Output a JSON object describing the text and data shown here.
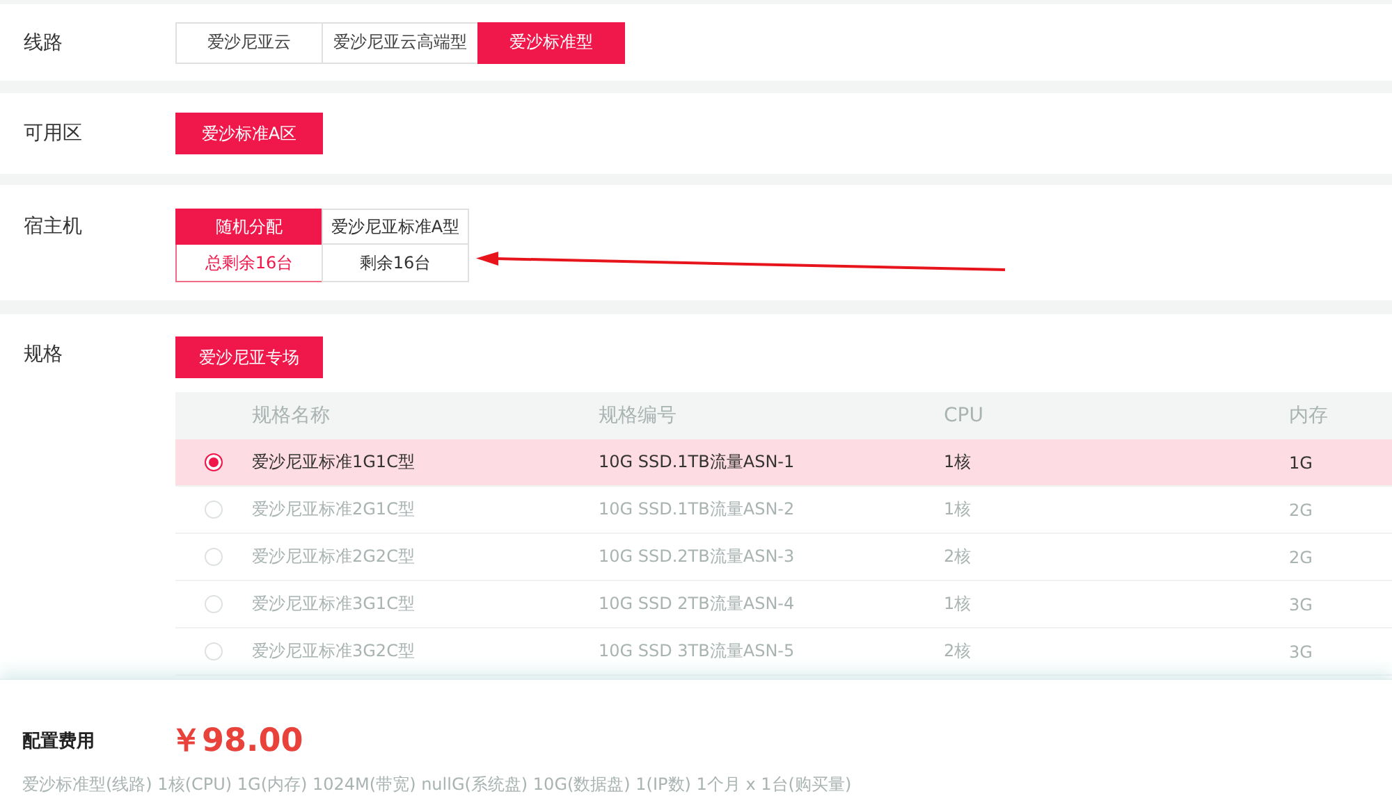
{
  "line": {
    "label": "线路",
    "options": [
      {
        "label": "爱沙尼亚云",
        "selected": false
      },
      {
        "label": "爱沙尼亚云高端型",
        "selected": false
      },
      {
        "label": "爱沙标准型",
        "selected": true
      }
    ]
  },
  "zone": {
    "label": "可用区",
    "options": [
      {
        "label": "爱沙标准A区",
        "selected": true
      }
    ]
  },
  "host": {
    "label": "宿主机",
    "options": [
      {
        "name": "随机分配",
        "remaining": "总剩余16台",
        "selected": true
      },
      {
        "name": "爱沙尼亚标准A型",
        "remaining": "剩余16台",
        "selected": false
      }
    ]
  },
  "spec": {
    "label": "规格",
    "groups": [
      {
        "label": "爱沙尼亚专场",
        "selected": true
      }
    ],
    "table": {
      "columns": [
        "规格名称",
        "规格编号",
        "CPU",
        "内存"
      ],
      "rows": [
        {
          "selected": true,
          "cells": [
            "爱沙尼亚标准1G1C型",
            "10G SSD.1TB流量ASN-1",
            "1核",
            "1G"
          ]
        },
        {
          "selected": false,
          "cells": [
            "爱沙尼亚标准2G1C型",
            "10G SSD.1TB流量ASN-2",
            "1核",
            "2G"
          ]
        },
        {
          "selected": false,
          "cells": [
            "爱沙尼亚标准2G2C型",
            "10G SSD.2TB流量ASN-3",
            "2核",
            "2G"
          ]
        },
        {
          "selected": false,
          "cells": [
            "爱沙尼亚标准3G1C型",
            "10G SSD 2TB流量ASN-4",
            "1核",
            "3G"
          ]
        },
        {
          "selected": false,
          "cells": [
            "爱沙尼亚标准3G2C型",
            "10G SSD 3TB流量ASN-5",
            "2核",
            "3G"
          ]
        }
      ]
    }
  },
  "footer": {
    "label": "配置费用",
    "price": "￥98.00",
    "summary": "爱沙标准型(线路) 1核(CPU) 1G(内存) 1024M(带宽) nullG(系统盘) 10G(数据盘) 1(IP数) 1个月 x 1台(购买量)"
  }
}
